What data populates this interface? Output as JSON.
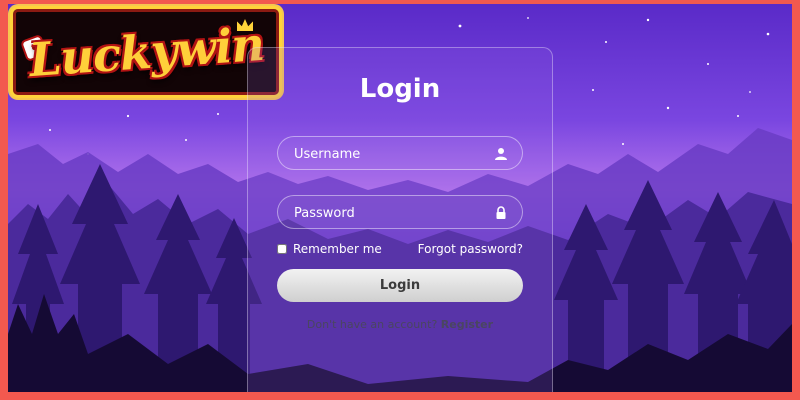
{
  "logo": {
    "text": "Luckywin"
  },
  "login": {
    "title": "Login",
    "username_placeholder": "Username",
    "password_placeholder": "Password",
    "remember_label": "Remember me",
    "forgot_label": "Forgot password?",
    "button_label": "Login",
    "no_account_text": "Don't have an account?",
    "register_label": "Register"
  },
  "colors": {
    "border": "#f2594f",
    "sky_top": "#5a2ac8",
    "sky_glow": "#b274ec",
    "logo_gold": "#ffcf3a",
    "logo_red": "#b11313",
    "button": "#e6e6e6"
  },
  "icons": {
    "username": "user-icon",
    "password": "lock-icon"
  }
}
